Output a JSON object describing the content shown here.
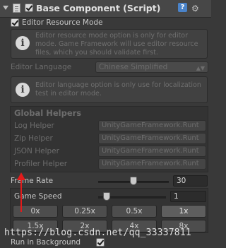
{
  "header": {
    "title": "Base Component (Script)",
    "enabled": true
  },
  "editor_resource_mode": {
    "label": "Editor Resource Mode",
    "checked": true,
    "info": "Editor resource mode option is only for editor mode. Game Framework will use editor resource files, which you should validate first."
  },
  "editor_language": {
    "label": "Editor Language",
    "value": "Chinese Simplified"
  },
  "language_info": "Editor language option is only use for localization test in editor mode.",
  "global_helpers": {
    "title": "Global Helpers",
    "items": [
      {
        "label": "Log Helper",
        "value": "UnityGameFramework.Runt"
      },
      {
        "label": "Zip Helper",
        "value": "UnityGameFramework.Runt"
      },
      {
        "label": "JSON Helper",
        "value": "UnityGameFramework.Runt"
      },
      {
        "label": "Profiler Helper",
        "value": "UnityGameFramework.Runt"
      }
    ]
  },
  "frame_rate": {
    "label": "Frame Rate",
    "value": "30",
    "slider_fraction": 0.5
  },
  "game_speed": {
    "label": "Game Speed",
    "value": "1",
    "slider_fraction": 0.125,
    "buttons": [
      "0x",
      "0.25x",
      "0.5x",
      "1x",
      "1.5x",
      "2x",
      "4x",
      "8x"
    ],
    "active": "1x"
  },
  "run_in_background": {
    "label": "Run in Background",
    "checked": true
  },
  "watermark": "https://blog.csdn.net/qq_33337811",
  "colors": {
    "panel_bg": "#393939",
    "annotation_arrow": "#e31b1b",
    "help_icon": "#4a83c9"
  },
  "icons": [
    "foldout-arrow-icon",
    "script-icon",
    "help-icon",
    "gear-icon",
    "info-icon"
  ]
}
